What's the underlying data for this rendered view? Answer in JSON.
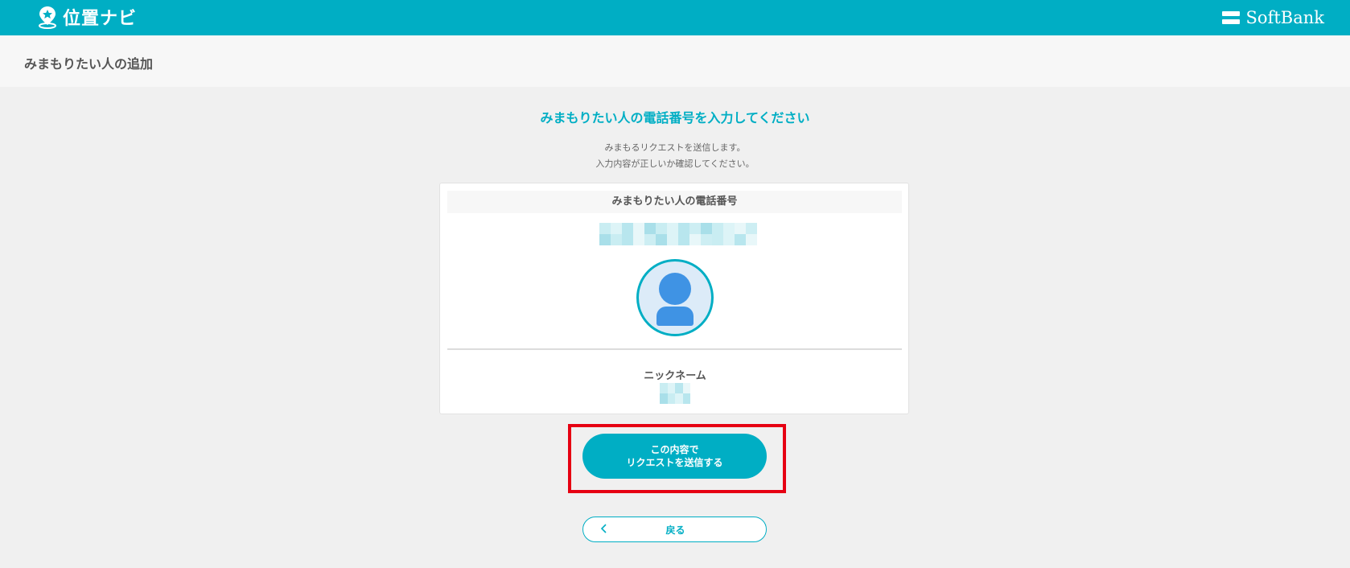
{
  "header": {
    "app_name": "位置ナビ",
    "brand_name": "SoftBank",
    "background_color": "#00aec4"
  },
  "subheader": {
    "title": "みまもりたい人の追加"
  },
  "main": {
    "heading": "みまもりたい人の電話番号を入力してください",
    "description_line1": "みまもるリクエストを送信します。",
    "description_line2": "入力内容が正しいか確認してください。"
  },
  "card": {
    "phone_label": "みまもりたい人の電話番号",
    "avatar_icon": "person-avatar-icon",
    "nickname_label": "ニックネーム"
  },
  "actions": {
    "submit_line1": "この内容で",
    "submit_line2": "リクエストを送信する",
    "back_label": "戻る",
    "highlight_color": "#e60012"
  }
}
